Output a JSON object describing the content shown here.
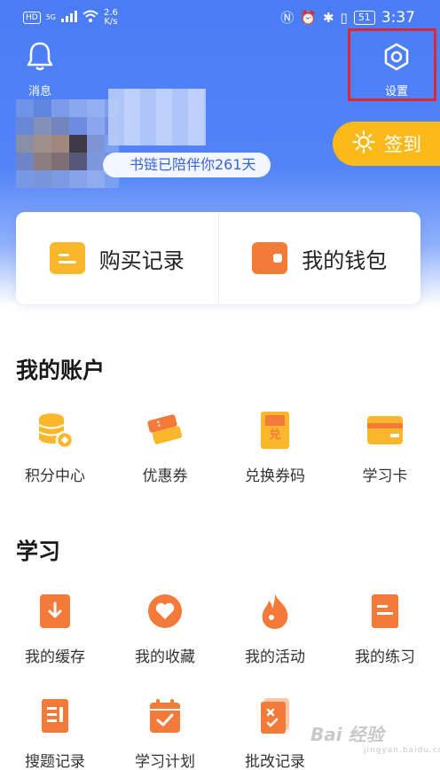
{
  "status_bar": {
    "hd": "HD",
    "network": "5G",
    "speed_value": "2.6",
    "speed_unit": "K/s",
    "battery": "51",
    "time": "3:37"
  },
  "header": {
    "messages_label": "消息",
    "settings_label": "设置"
  },
  "profile": {
    "companion_text": "书链已陪伴你261天",
    "signin_label": "签到"
  },
  "cards": {
    "purchase_label": "购买记录",
    "wallet_label": "我的钱包"
  },
  "account": {
    "title": "我的账户",
    "items": [
      {
        "label": "积分中心",
        "icon": "coins-icon"
      },
      {
        "label": "优惠券",
        "icon": "coupon-icon"
      },
      {
        "label": "兑换券码",
        "icon": "redeem-code-icon"
      },
      {
        "label": "学习卡",
        "icon": "study-card-icon"
      }
    ]
  },
  "study": {
    "title": "学习",
    "items": [
      {
        "label": "我的缓存",
        "icon": "download-icon"
      },
      {
        "label": "我的收藏",
        "icon": "heart-icon"
      },
      {
        "label": "我的活动",
        "icon": "flame-icon"
      },
      {
        "label": "我的练习",
        "icon": "exercise-icon"
      },
      {
        "label": "搜题记录",
        "icon": "search-record-icon"
      },
      {
        "label": "学习计划",
        "icon": "plan-icon"
      },
      {
        "label": "批改记录",
        "icon": "correction-icon"
      }
    ]
  },
  "watermark": {
    "brand": "Bai 经验",
    "url": "jingyan.baidu.com"
  },
  "colors": {
    "primary_blue": "#4a7cf6",
    "signin_yellow": "#fbba17",
    "icon_orange": "#f47a3a",
    "icon_yellow": "#fbb72c",
    "highlight_red": "#e0262f"
  }
}
